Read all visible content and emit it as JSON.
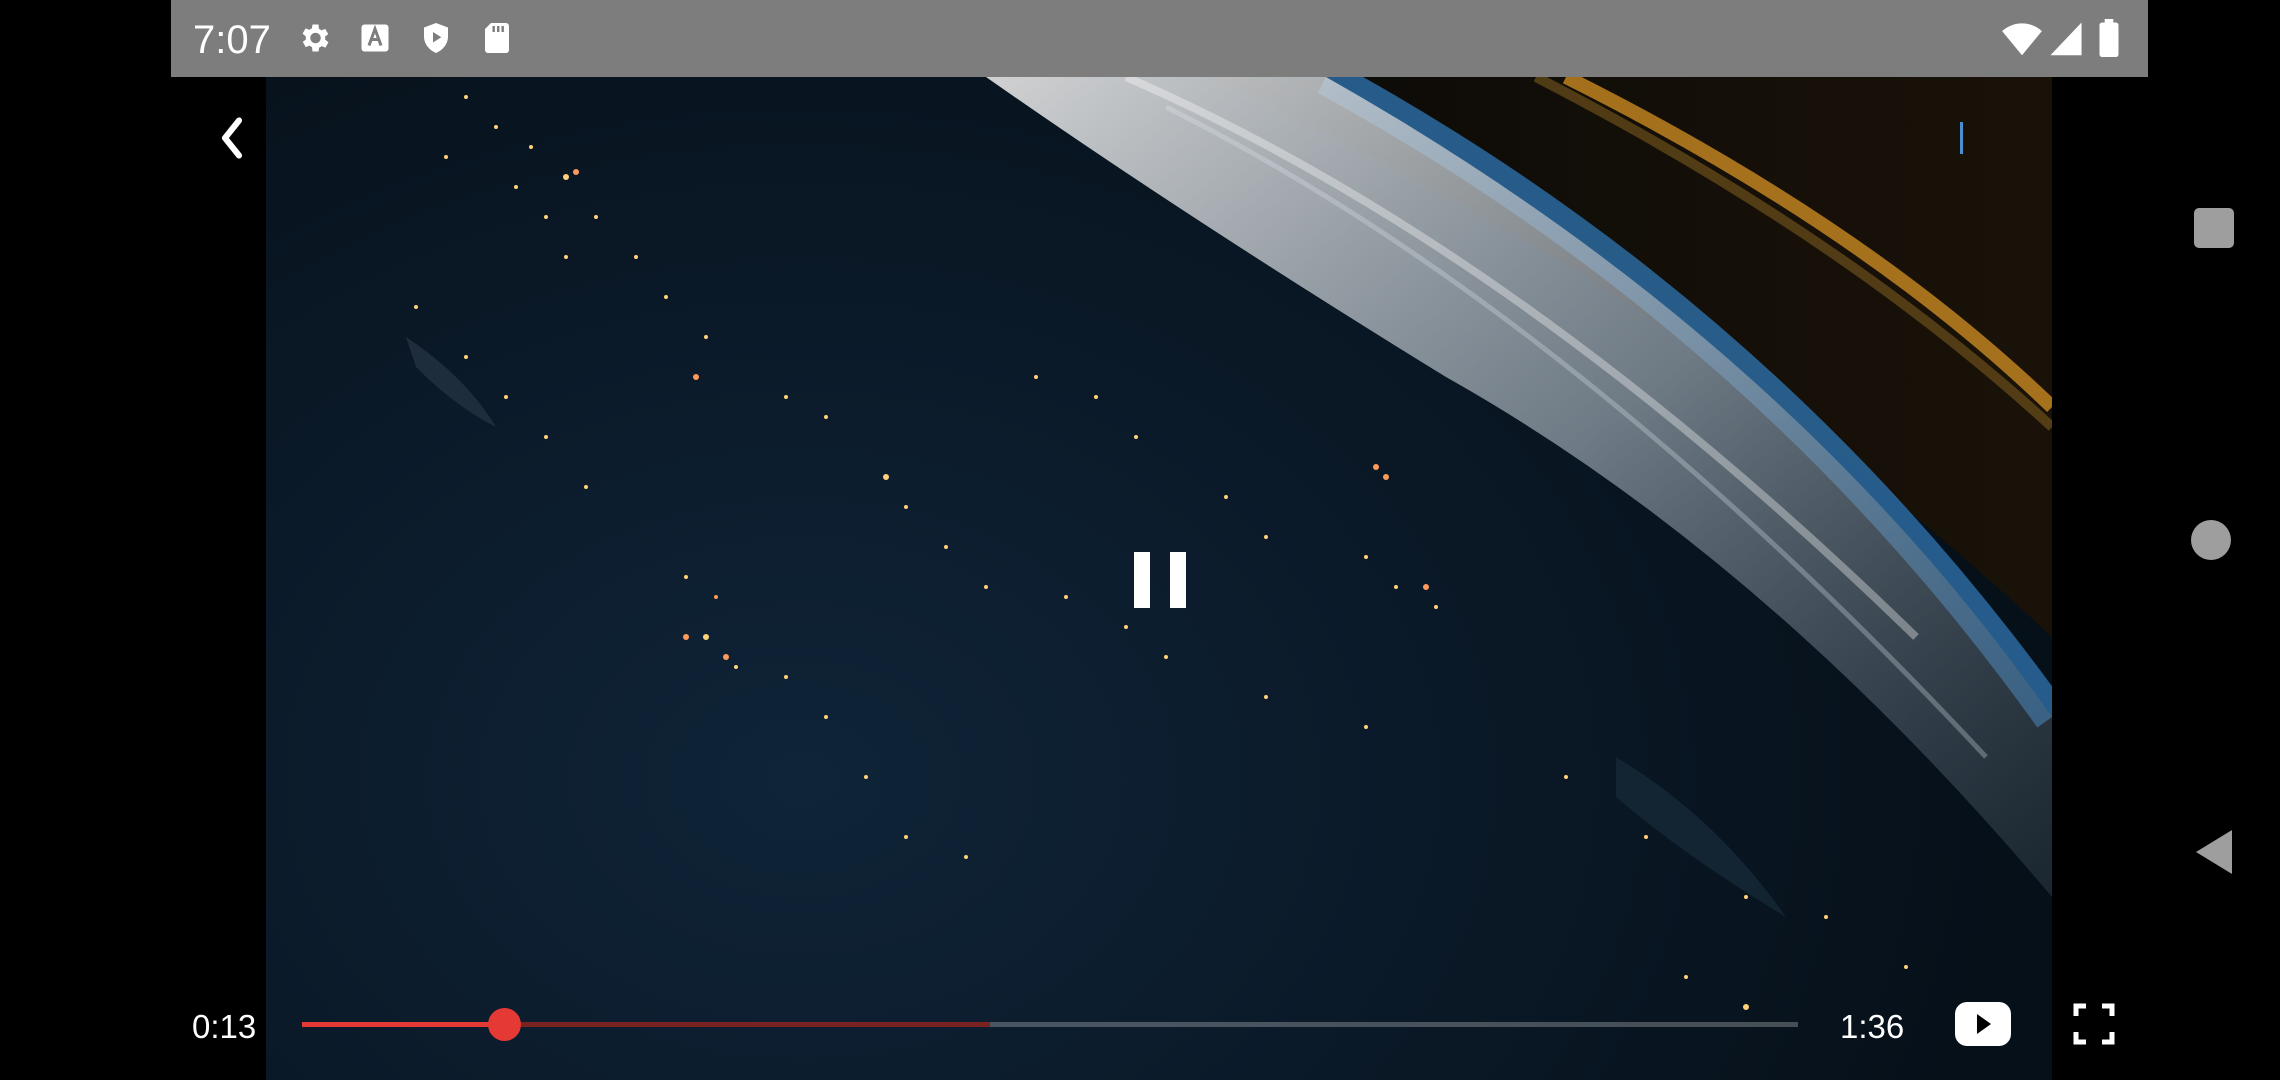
{
  "status_bar": {
    "time": "7:07",
    "left_icons": [
      "gear-icon",
      "font-a-icon",
      "shield-play-icon",
      "sd-card-icon"
    ],
    "right_icons": [
      "wifi-icon",
      "cell-signal-icon",
      "battery-icon"
    ]
  },
  "player": {
    "current_time": "0:13",
    "duration": "1:36",
    "progress_fraction": 0.135,
    "buffered_fraction": 0.46,
    "state_button": "pause",
    "accent_color": "#e53935"
  },
  "nav_bar": {
    "buttons": [
      "recents",
      "home",
      "back"
    ]
  }
}
